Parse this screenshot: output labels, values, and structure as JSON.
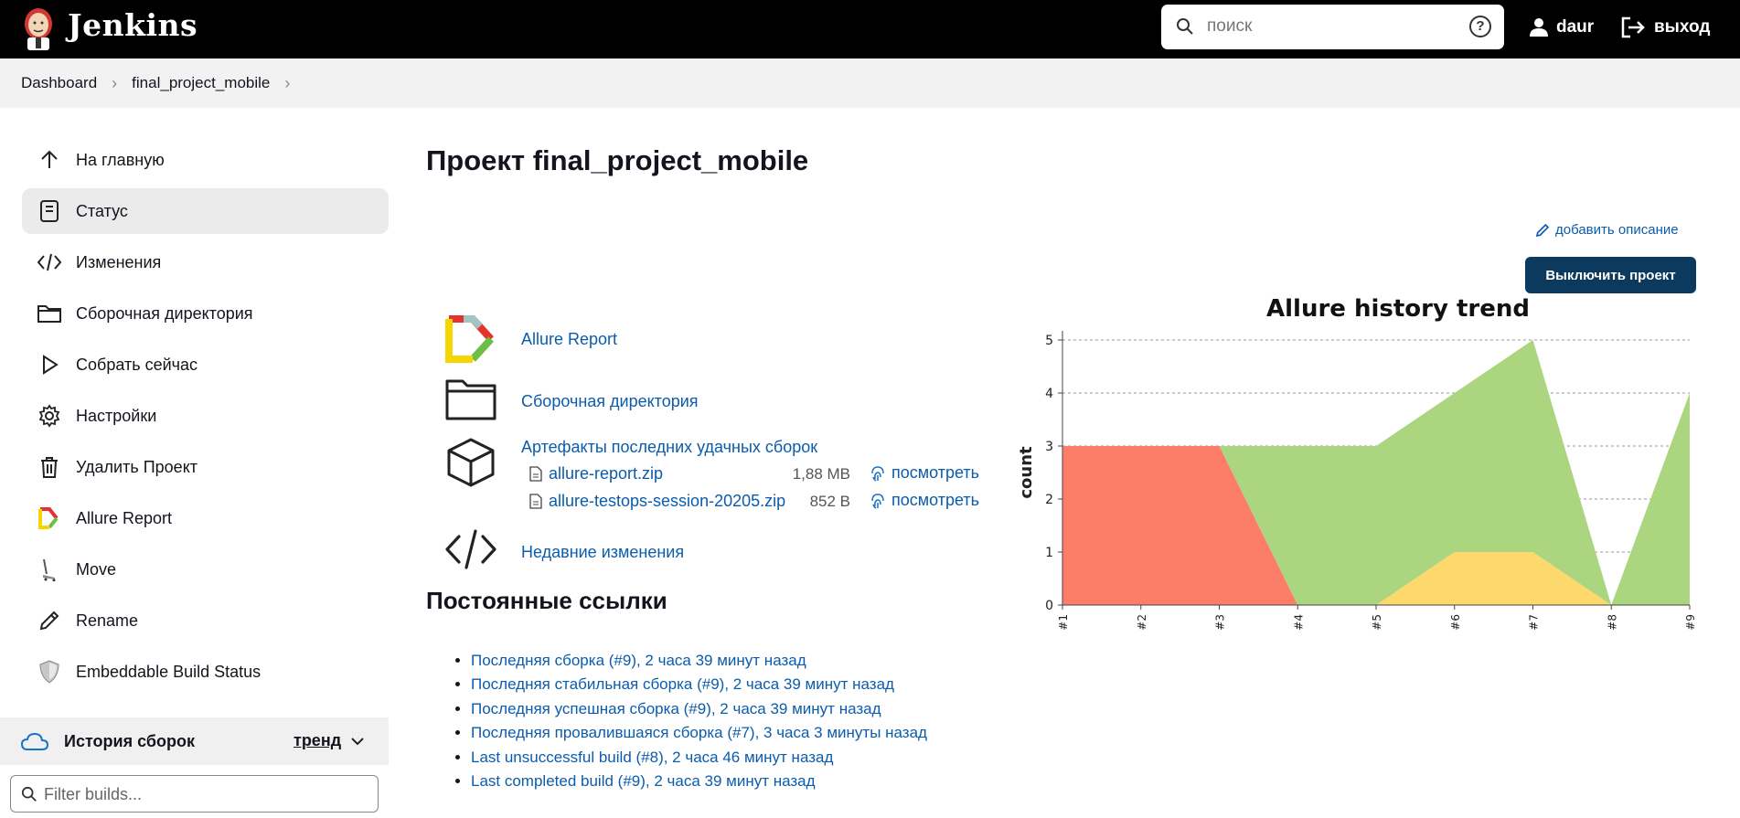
{
  "header": {
    "brand": "Jenkins",
    "search_placeholder": "поиск",
    "user_name": "daur",
    "logout_label": "выход"
  },
  "breadcrumb": {
    "items": [
      "Dashboard",
      "final_project_mobile"
    ]
  },
  "sidebar": {
    "items": [
      {
        "label": "На главную",
        "icon": "arrow-up-icon"
      },
      {
        "label": "Статус",
        "icon": "document-icon"
      },
      {
        "label": "Изменения",
        "icon": "code-icon"
      },
      {
        "label": "Сборочная директория",
        "icon": "folder-icon"
      },
      {
        "label": "Собрать сейчас",
        "icon": "play-icon"
      },
      {
        "label": "Настройки",
        "icon": "gear-icon"
      },
      {
        "label": "Удалить Проект",
        "icon": "trash-icon"
      },
      {
        "label": "Allure Report",
        "icon": "allure-icon"
      },
      {
        "label": "Move",
        "icon": "move-icon"
      },
      {
        "label": "Rename",
        "icon": "pencil-icon"
      },
      {
        "label": "Embeddable Build Status",
        "icon": "shield-icon"
      }
    ],
    "active_index": 1,
    "history_title": "История сборок",
    "history_trend": "тренд",
    "filter_placeholder": "Filter builds..."
  },
  "main": {
    "title": "Проект final_project_mobile",
    "add_description": "добавить описание",
    "disable_button": "Выключить проект",
    "links": {
      "allure_report": "Allure Report",
      "workspace": "Сборочная директория",
      "artifacts_title": "Артефакты последних удачных сборок",
      "recent_changes": "Недавние изменения"
    },
    "artifacts": [
      {
        "name": "allure-report.zip",
        "size": "1,88 MB",
        "view": "посмотреть"
      },
      {
        "name": "allure-testops-session-20205.zip",
        "size": "852 B",
        "view": "посмотреть"
      }
    ],
    "permalinks_title": "Постоянные ссылки",
    "permalinks": [
      "Последняя сборка (#9), 2 часа 39 минут назад",
      "Последняя стабильная сборка (#9), 2 часа 39 минут назад",
      "Последняя успешная сборка (#9), 2 часа 39 минут назад",
      "Последняя провалившаяся сборка (#7), 3 часа 3 минуты назад",
      "Last unsuccessful build (#8), 2 часа 46 минут назад",
      "Last completed build (#9), 2 часа 39 минут назад"
    ]
  },
  "chart_data": {
    "type": "area",
    "title": "Allure history trend",
    "xlabel": "",
    "ylabel": "count",
    "x": [
      "#1",
      "#2",
      "#3",
      "#4",
      "#5",
      "#6",
      "#7",
      "#8",
      "#9"
    ],
    "ylim": [
      0,
      5
    ],
    "yticks": [
      0,
      1,
      2,
      3,
      4,
      5
    ],
    "grid": true,
    "series": [
      {
        "color": "#fd7e68",
        "values": [
          3,
          3,
          3,
          0,
          0,
          0,
          0,
          0,
          0
        ]
      },
      {
        "color": "#fdd96d",
        "values": [
          0,
          0,
          0,
          0,
          0,
          1,
          1,
          0,
          0
        ]
      },
      {
        "color": "#acd580",
        "values": [
          0,
          0,
          0,
          3,
          3,
          3,
          4,
          0,
          4
        ]
      }
    ]
  },
  "colors": {
    "header_bg": "#000000",
    "link": "#0b5cad",
    "button_bg": "#0b3a5e",
    "active_item_bg": "#ebebeb"
  }
}
